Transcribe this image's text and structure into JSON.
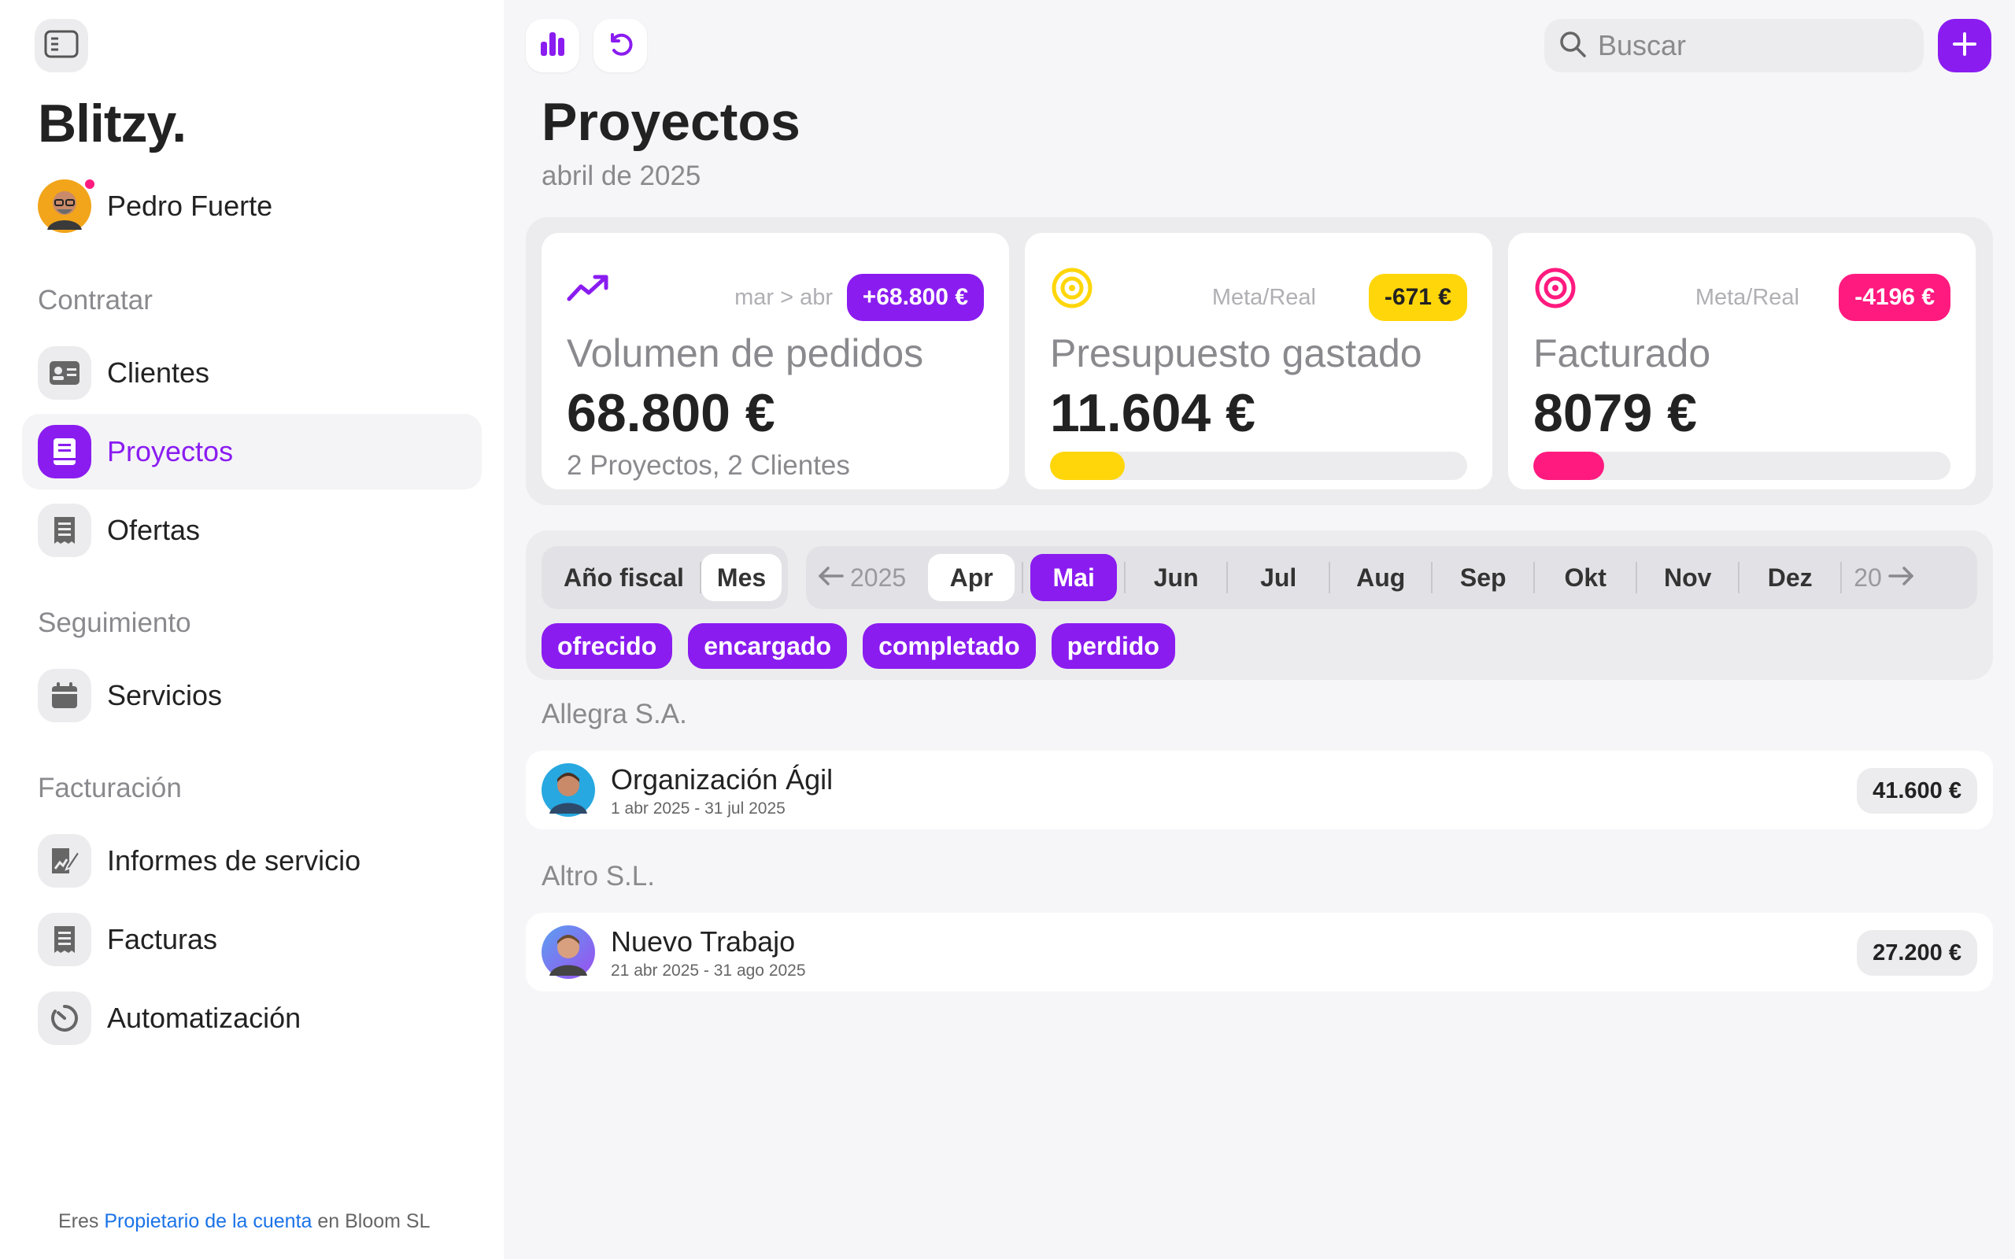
{
  "app": {
    "logo": "Blitzy."
  },
  "user": {
    "name": "Pedro Fuerte"
  },
  "sidebar": {
    "sections": [
      {
        "title": "Contratar",
        "items": [
          {
            "label": "Clientes"
          },
          {
            "label": "Proyectos",
            "active": true
          },
          {
            "label": "Ofertas"
          }
        ]
      },
      {
        "title": "Seguimiento",
        "items": [
          {
            "label": "Servicios"
          }
        ]
      },
      {
        "title": "Facturación",
        "items": [
          {
            "label": "Informes de servicio"
          },
          {
            "label": "Facturas"
          },
          {
            "label": "Automatización"
          }
        ]
      }
    ],
    "footer": {
      "prefix": "Eres ",
      "link": "Propietario de la cuenta",
      "suffix": " en Bloom SL"
    }
  },
  "search": {
    "placeholder": "Buscar",
    "value": ""
  },
  "page": {
    "title": "Proyectos",
    "subtitle": "abril de 2025"
  },
  "cards": [
    {
      "meta": "mar > abr",
      "badge": "+68.800 €",
      "title": "Volumen de pedidos",
      "value": "68.800 €",
      "sub": "2 Proyectos, 2 Clientes"
    },
    {
      "meta": "Meta/Real",
      "badge": "-671 €",
      "title": "Presupuesto gastado",
      "value": "11.604 €",
      "progress": 0.18,
      "color": "#ffd60a"
    },
    {
      "meta": "Meta/Real",
      "badge": "-4196 €",
      "title": "Facturado",
      "value": "8079 €",
      "progress": 0.17,
      "color": "#ff1a7f"
    }
  ],
  "colors": {
    "accent": "#8a1cf0",
    "yellow": "#ffd60a",
    "pink": "#ff1a7f"
  },
  "filters": {
    "period_tabs": [
      {
        "label": "Año fiscal"
      },
      {
        "label": "Mes",
        "active": true
      }
    ],
    "year_prev": "2025",
    "months": [
      "Apr",
      "Mai",
      "Jun",
      "Jul",
      "Aug",
      "Sep",
      "Okt",
      "Nov",
      "Dez"
    ],
    "year_next": "20",
    "status_tags": [
      "ofrecido",
      "encargado",
      "completado",
      "perdido"
    ]
  },
  "groups": [
    {
      "client": "Allegra S.A.",
      "project": {
        "name": "Organización Ágil",
        "dates": "1 abr 2025 - 31 jul 2025",
        "amount": "41.600 €"
      }
    },
    {
      "client": "Altro S.L.",
      "project": {
        "name": "Nuevo Trabajo",
        "dates": "21 abr 2025 - 31 ago 2025",
        "amount": "27.200 €"
      }
    }
  ]
}
